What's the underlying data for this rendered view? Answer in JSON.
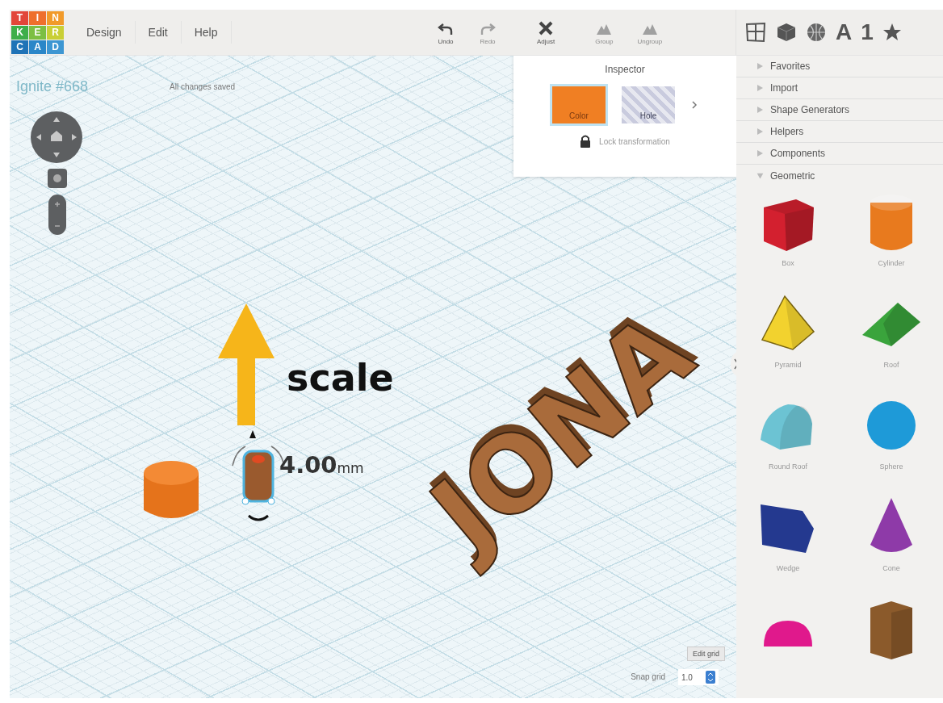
{
  "logo_letters": [
    "T",
    "I",
    "N",
    "K",
    "E",
    "R",
    "C",
    "A",
    "D"
  ],
  "menu": [
    "Design",
    "Edit",
    "Help"
  ],
  "toolbar": [
    {
      "kind": "undo",
      "label": "Undo",
      "disabled": false
    },
    {
      "kind": "redo",
      "label": "Redo",
      "disabled": true
    },
    {
      "kind": "adjust",
      "label": "Adjust",
      "disabled": false
    },
    {
      "kind": "group",
      "label": "Group",
      "disabled": true
    },
    {
      "kind": "ungroup",
      "label": "Ungroup",
      "disabled": true
    }
  ],
  "panel_tabs": [
    {
      "kind": "grid"
    },
    {
      "kind": "cube"
    },
    {
      "kind": "globe"
    },
    {
      "kind": "text",
      "label": "A"
    },
    {
      "kind": "text",
      "label": "1"
    },
    {
      "kind": "star"
    }
  ],
  "design": {
    "title": "Ignite #668",
    "save_status": "All changes saved"
  },
  "inspector": {
    "title": "Inspector",
    "swatches": [
      {
        "kind": "solid",
        "label": "Color",
        "selected": true
      },
      {
        "kind": "hole",
        "label": "Hole",
        "selected": false
      }
    ],
    "lock_label": "Lock transformation"
  },
  "scene": {
    "model_text": "JONA",
    "annotation": "scale",
    "dimension": {
      "value": "4.00",
      "unit": "mm"
    }
  },
  "grid": {
    "edit_button": "Edit grid",
    "snap_label": "Snap grid",
    "snap_value": "1.0"
  },
  "library": {
    "sections": [
      {
        "label": "Favorites",
        "expanded": false
      },
      {
        "label": "Import",
        "expanded": false
      },
      {
        "label": "Shape Generators",
        "expanded": false
      },
      {
        "label": "Helpers",
        "expanded": false
      },
      {
        "label": "Components",
        "expanded": false
      },
      {
        "label": "Geometric",
        "expanded": true
      }
    ],
    "shapes": [
      {
        "kind": "box",
        "label": "Box",
        "color": "#d3202f"
      },
      {
        "kind": "cylinder",
        "label": "Cylinder",
        "color": "#e87a1e"
      },
      {
        "kind": "pyramid",
        "label": "Pyramid",
        "color": "#f2d22e"
      },
      {
        "kind": "roof",
        "label": "Roof",
        "color": "#3aa43c"
      },
      {
        "kind": "round-roof",
        "label": "Round Roof",
        "color": "#6cc3d3"
      },
      {
        "kind": "sphere",
        "label": "Sphere",
        "color": "#1e9ad8"
      },
      {
        "kind": "wedge",
        "label": "Wedge",
        "color": "#24398f"
      },
      {
        "kind": "cone",
        "label": "Cone",
        "color": "#8e3aa8"
      },
      {
        "kind": "half-sphere",
        "color": "#e0198c"
      },
      {
        "kind": "polygon",
        "color": "#8b5a2b"
      }
    ]
  }
}
